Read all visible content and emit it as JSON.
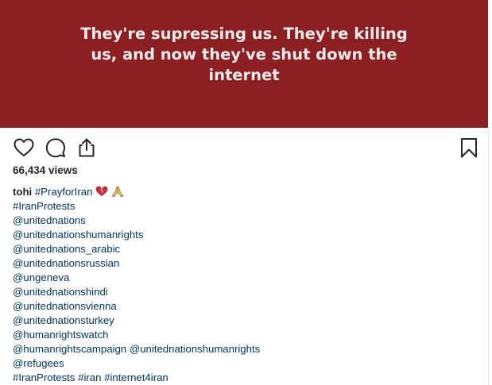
{
  "post": {
    "image_text": "They're supressing us. They're killing us, and now they've shut down the internet",
    "image_bg_color": "#8b1f22"
  },
  "actions": {
    "like_icon": "heart-outline-icon",
    "comment_icon": "comment-bubble-icon",
    "share_icon": "share-upload-icon",
    "save_icon": "bookmark-icon"
  },
  "views": "66,434 views",
  "caption": {
    "username": "tohi",
    "first_tag": "#PrayforIran",
    "emojis": [
      "broken-heart-icon",
      "folded-hands-icon"
    ],
    "lines": [
      "#IranProtests",
      "@unitednations",
      "@unitednationshumanrights",
      "@unitednations_arabic",
      "@unitednationsrussian",
      "@ungeneva",
      "@unitednationshindi",
      "@unitednationsvienna",
      "@unitednationsturkey",
      "@humanrightswatch",
      "@humanrightscampaign @unitednationshumanrights",
      "@refugees",
      "#IranProtests #iran #internet4iran"
    ]
  },
  "colors": {
    "tag": "#003569",
    "text": "#262626"
  }
}
